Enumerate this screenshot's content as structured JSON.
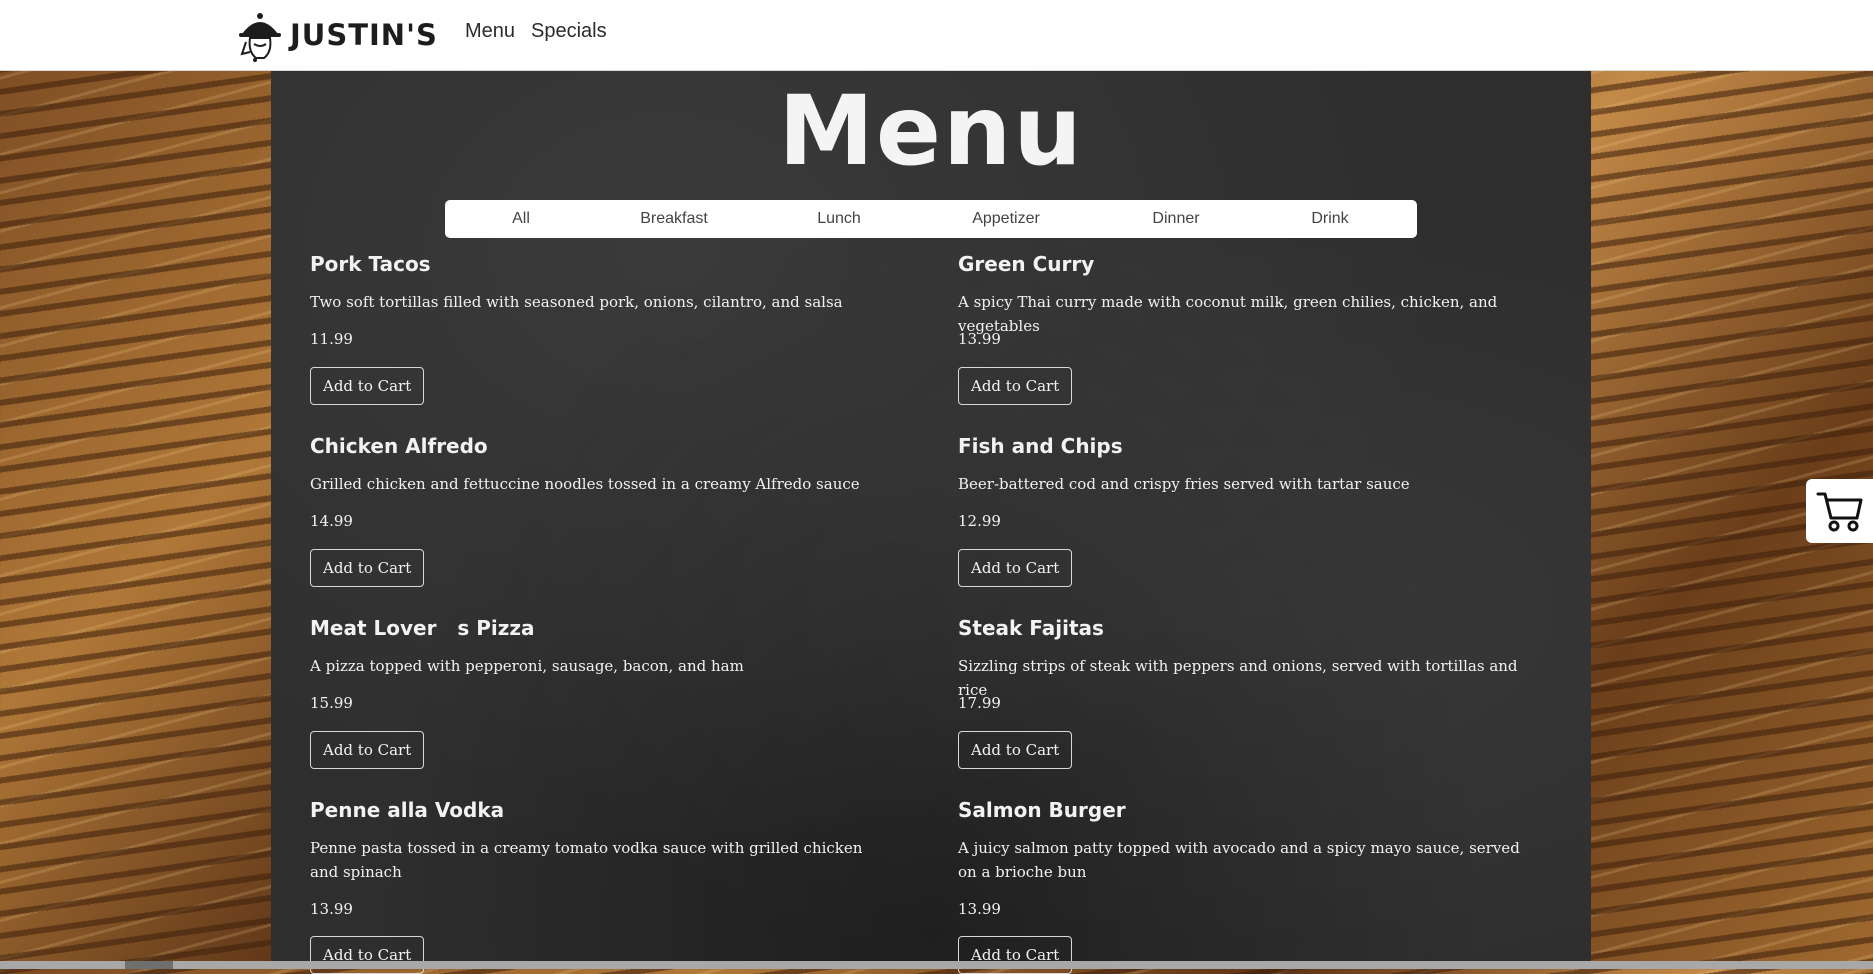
{
  "navbar": {
    "brand": "JUSTIN'S",
    "links": [
      "Menu",
      "Specials"
    ]
  },
  "page": {
    "title": "Menu"
  },
  "tabs": [
    "All",
    "Breakfast",
    "Lunch",
    "Appetizer",
    "Dinner",
    "Drink"
  ],
  "add_label": "Add to Cart",
  "items": [
    {
      "name": "Pork Tacos",
      "desc": "Two soft tortillas filled with seasoned pork, onions, cilantro, and salsa",
      "price": "11.99"
    },
    {
      "name": "Green Curry",
      "desc": "A spicy Thai curry made with coconut milk, green chilies, chicken, and vegetables",
      "price": "13.99"
    },
    {
      "name": "Chicken Alfredo",
      "desc": "Grilled chicken and fettuccine noodles tossed in a creamy Alfredo sauce",
      "price": "14.99"
    },
    {
      "name": "Fish and Chips",
      "desc": "Beer-battered cod and crispy fries served with tartar sauce",
      "price": "12.99"
    },
    {
      "name": "Meat Lover   s Pizza",
      "desc": "A pizza topped with pepperoni, sausage, bacon, and ham",
      "price": "15.99"
    },
    {
      "name": "Steak Fajitas",
      "desc": "Sizzling strips of steak with peppers and onions, served with tortillas and rice",
      "price": "17.99"
    },
    {
      "name": "Penne alla Vodka",
      "desc": "Penne pasta tossed in a creamy tomato vodka sauce with grilled chicken and spinach",
      "price": "13.99"
    },
    {
      "name": "Salmon Burger",
      "desc": "A juicy salmon patty topped with avocado and a spicy mayo sauce, served on a brioche bun",
      "price": "13.99"
    }
  ],
  "icons": {
    "logo": "chef-cloche-logo",
    "cart": "shopping-cart-icon"
  }
}
